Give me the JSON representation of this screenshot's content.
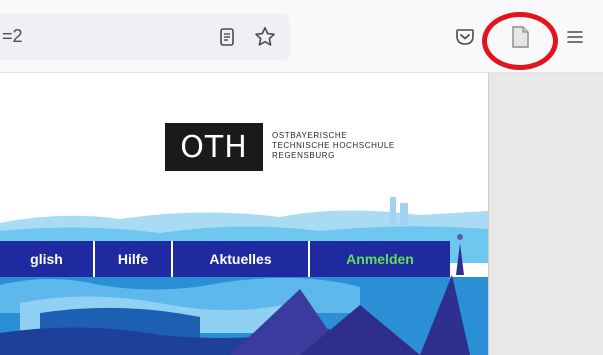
{
  "toolbar": {
    "url_fragment": "=2",
    "icons": [
      "reader-view-icon",
      "bookmark-star-icon",
      "pocket-icon",
      "document-icon",
      "hamburger-menu-icon"
    ],
    "highlight_color": "#e2141d"
  },
  "page": {
    "logo": {
      "letters": "OTH",
      "line1": "OSTBAYERISCHE",
      "line2": "TECHNISCHE HOCHSCHULE",
      "line3": "REGENSBURG"
    },
    "nav": {
      "items": [
        "glish",
        "Hilfe",
        "Aktuelles",
        "Anmelden"
      ],
      "bg_color": "#1f2aa0",
      "login_color": "#5fe05a"
    }
  }
}
